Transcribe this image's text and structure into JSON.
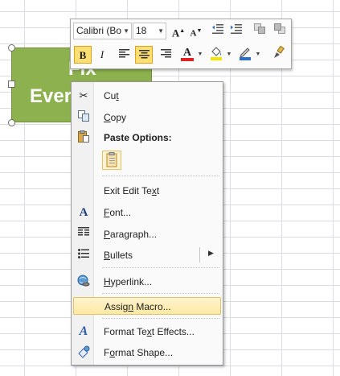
{
  "shape": {
    "line1": "Fix",
    "line2": "Ever"
  },
  "mini_toolbar": {
    "font_name": "Calibri (Bo",
    "font_size": "18",
    "grow_font": "A",
    "shrink_font": "A",
    "bold": "B",
    "italic": "I",
    "font_color_glyph": "A",
    "accent_red": "#e02020",
    "accent_yellow": "#f5e400"
  },
  "context_menu": {
    "cut": {
      "pre": "Cu",
      "key": "t",
      "post": ""
    },
    "copy": {
      "pre": "",
      "key": "C",
      "post": "opy"
    },
    "paste_options": "Paste Options:",
    "exit_edit_text": {
      "pre": "Exit Edit Te",
      "key": "x",
      "post": "t"
    },
    "font": {
      "pre": "",
      "key": "F",
      "post": "ont..."
    },
    "paragraph": {
      "pre": "",
      "key": "P",
      "post": "aragraph..."
    },
    "bullets": {
      "pre": "",
      "key": "B",
      "post": "ullets"
    },
    "hyperlink": {
      "pre": "",
      "key": "H",
      "post": "yperlink..."
    },
    "assign_macro": {
      "pre": "Assig",
      "key": "n",
      "post": " Macro..."
    },
    "format_text_effects": {
      "pre": "Format Te",
      "key": "x",
      "post": "t Effects..."
    },
    "format_shape": {
      "pre": "F",
      "key": "o",
      "post": "rmat Shape..."
    }
  }
}
